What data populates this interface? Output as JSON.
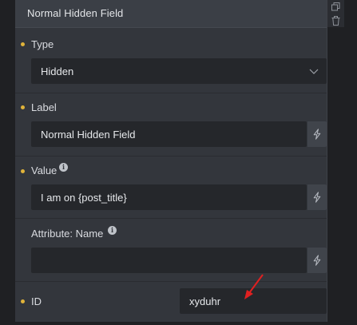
{
  "panel": {
    "title": "Normal Hidden Field"
  },
  "side_tools": [
    {
      "icon": "duplicate-icon"
    },
    {
      "icon": "trash-icon"
    }
  ],
  "fields": {
    "type": {
      "label": "Type",
      "value": "Hidden",
      "icon": "chevron-down-icon"
    },
    "label": {
      "label": "Label",
      "value": "Normal Hidden Field",
      "dynamic_icon": "lightning-icon"
    },
    "value": {
      "label": "Value",
      "value": "I am on {post_title}",
      "info_icon": "info-icon",
      "dynamic_icon": "lightning-icon"
    },
    "attribute_name": {
      "label": "Attribute: Name",
      "value": "",
      "info_icon": "info-icon",
      "dynamic_icon": "lightning-icon"
    },
    "id": {
      "label": "ID",
      "value": "xyduhr"
    }
  },
  "colors": {
    "accent_bullet": "#e0b33a",
    "annotation_arrow": "#e02020"
  }
}
